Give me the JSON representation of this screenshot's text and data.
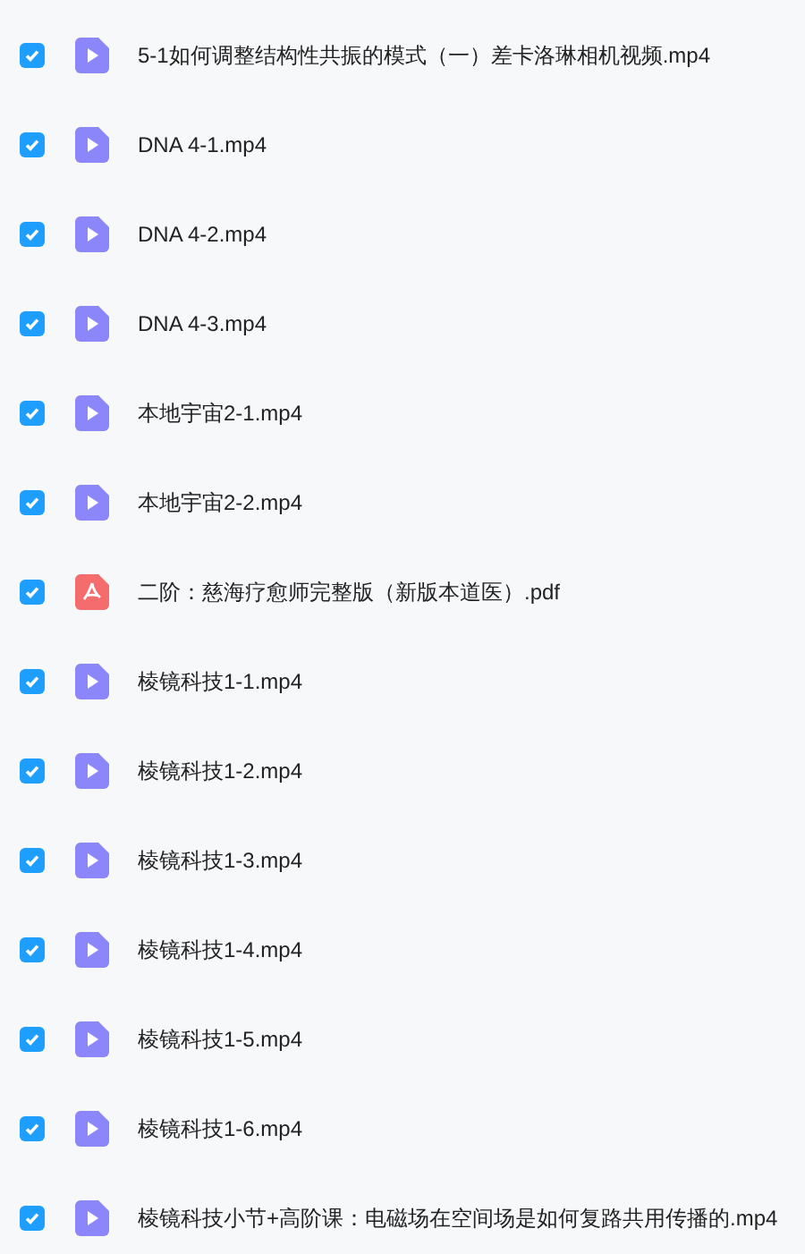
{
  "files": [
    {
      "name": "5-1如何调整结构性共振的模式（一）差卡洛琳相机视频.mp4",
      "kind": "video",
      "checked": true
    },
    {
      "name": "DNA 4-1.mp4",
      "kind": "video",
      "checked": true
    },
    {
      "name": "DNA 4-2.mp4",
      "kind": "video",
      "checked": true
    },
    {
      "name": "DNA 4-3.mp4",
      "kind": "video",
      "checked": true
    },
    {
      "name": "本地宇宙2-1.mp4",
      "kind": "video",
      "checked": true
    },
    {
      "name": "本地宇宙2-2.mp4",
      "kind": "video",
      "checked": true
    },
    {
      "name": "二阶：慈海疗愈师完整版（新版本道医）.pdf",
      "kind": "pdf",
      "checked": true
    },
    {
      "name": "棱镜科技1-1.mp4",
      "kind": "video",
      "checked": true
    },
    {
      "name": "棱镜科技1-2.mp4",
      "kind": "video",
      "checked": true
    },
    {
      "name": "棱镜科技1-3.mp4",
      "kind": "video",
      "checked": true
    },
    {
      "name": "棱镜科技1-4.mp4",
      "kind": "video",
      "checked": true
    },
    {
      "name": "棱镜科技1-5.mp4",
      "kind": "video",
      "checked": true
    },
    {
      "name": "棱镜科技1-6.mp4",
      "kind": "video",
      "checked": true
    },
    {
      "name": "棱镜科技小节+高阶课：电磁场在空间场是如何复路共用传播的.mp4",
      "kind": "video",
      "checked": true
    }
  ]
}
